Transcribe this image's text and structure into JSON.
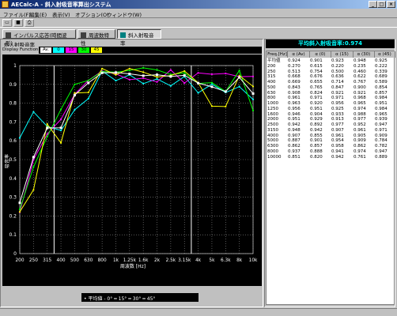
{
  "window": {
    "title": "AECalc-A - 斜入射吸音率算出システム",
    "minimize": "_",
    "maximize": "□",
    "close": "×"
  },
  "menu": [
    "ファイル(F)",
    "編集(E)",
    "表示(V)",
    "オプション(O)",
    "ウィンドウ(W)"
  ],
  "tabs": [
    {
      "label": "インパルス応答(時間波形)"
    },
    {
      "label": "周波数特性"
    },
    {
      "label": "斜入射吸音率"
    }
  ],
  "panel_title": "斜入射吸音率",
  "display_function": {
    "label": "Display Function",
    "buttons": [
      {
        "label": "Av.",
        "color": "#ffffff"
      },
      {
        "label": "0",
        "color": "#00ffff"
      },
      {
        "label": "15",
        "color": "#ff00ff"
      },
      {
        "label": "30",
        "color": "#00ff00"
      },
      {
        "label": "45",
        "color": "#ffff00"
      }
    ]
  },
  "avg_title": "平均斜入射吸音率:0.974",
  "legend": "• 平均値 - 0° ━ 15° ━ 30° ━ 45°",
  "table": {
    "headers": [
      "Freq.[Hz]",
      "α (Av)",
      "α (0)",
      "α (15)",
      "α (30)",
      "α (45)"
    ],
    "rows": [
      [
        "平均値",
        "0.924",
        "0.901",
        "0.923",
        "0.948",
        "0.925"
      ],
      [
        "200",
        "0.270",
        "0.615",
        "0.220",
        "0.235",
        "0.222"
      ],
      [
        "250",
        "0.513",
        "0.754",
        "0.500",
        "0.460",
        "0.339"
      ],
      [
        "315",
        "0.668",
        "0.676",
        "0.636",
        "0.622",
        "0.689"
      ],
      [
        "400",
        "0.669",
        "0.655",
        "0.714",
        "0.767",
        "0.589"
      ],
      [
        "500",
        "0.843",
        "0.765",
        "0.847",
        "0.900",
        "0.854"
      ],
      [
        "630",
        "0.908",
        "0.824",
        "0.921",
        "0.921",
        "0.857"
      ],
      [
        "800",
        "0.961",
        "0.971",
        "0.971",
        "0.968",
        "0.984"
      ],
      [
        "1000",
        "0.963",
        "0.920",
        "0.956",
        "0.965",
        "0.951"
      ],
      [
        "1250",
        "0.956",
        "0.951",
        "0.925",
        "0.974",
        "0.984"
      ],
      [
        "1600",
        "0.946",
        "0.904",
        "0.933",
        "0.988",
        "0.965"
      ],
      [
        "2000",
        "0.951",
        "0.929",
        "0.913",
        "0.977",
        "0.939"
      ],
      [
        "2500",
        "0.942",
        "0.892",
        "0.977",
        "0.952",
        "0.947"
      ],
      [
        "3150",
        "0.948",
        "0.942",
        "0.907",
        "0.961",
        "0.971"
      ],
      [
        "4000",
        "0.907",
        "0.855",
        "0.961",
        "0.905",
        "0.909"
      ],
      [
        "5000",
        "0.887",
        "0.901",
        "0.954",
        "0.909",
        "0.784"
      ],
      [
        "6300",
        "0.862",
        "0.857",
        "0.958",
        "0.862",
        "0.782"
      ],
      [
        "8000",
        "0.937",
        "0.888",
        "0.941",
        "0.974",
        "0.947"
      ],
      [
        "10000",
        "0.851",
        "0.820",
        "0.942",
        "0.761",
        "0.889"
      ]
    ]
  },
  "chart_data": {
    "type": "line",
    "ylabel": "吸音率",
    "xlabel": "周波数 [Hz]",
    "ylim": [
      0,
      1
    ],
    "yticks": [
      "0",
      "0.1",
      "0.2",
      "0.3",
      "0.4",
      "0.5",
      "0.6",
      "0.7",
      "0.8",
      "0.9",
      "1"
    ],
    "categories": [
      "200",
      "250",
      "315",
      "400",
      "500",
      "630",
      "800",
      "1k",
      "1.25k",
      "1.6k",
      "2k",
      "2.5k",
      "3.15k",
      "4k",
      "5k",
      "6.3k",
      "8k",
      "10k"
    ],
    "series": [
      {
        "name": "平均値",
        "color": "#ffffff",
        "values": [
          0.27,
          0.513,
          0.668,
          0.669,
          0.843,
          0.908,
          0.961,
          0.963,
          0.956,
          0.946,
          0.951,
          0.942,
          0.948,
          0.907,
          0.887,
          0.862,
          0.937,
          0.851
        ]
      },
      {
        "name": "0°",
        "color": "#00ffff",
        "values": [
          0.615,
          0.754,
          0.676,
          0.655,
          0.765,
          0.824,
          0.971,
          0.92,
          0.951,
          0.904,
          0.929,
          0.892,
          0.942,
          0.855,
          0.901,
          0.857,
          0.888,
          0.82
        ]
      },
      {
        "name": "15°",
        "color": "#ff00ff",
        "values": [
          0.22,
          0.5,
          0.636,
          0.714,
          0.847,
          0.921,
          0.971,
          0.956,
          0.925,
          0.933,
          0.913,
          0.977,
          0.907,
          0.961,
          0.954,
          0.958,
          0.941,
          0.942
        ]
      },
      {
        "name": "30°",
        "color": "#00ff00",
        "values": [
          0.235,
          0.46,
          0.622,
          0.767,
          0.9,
          0.921,
          0.968,
          0.965,
          0.974,
          0.988,
          0.977,
          0.952,
          0.961,
          0.905,
          0.909,
          0.862,
          0.974,
          0.761
        ]
      },
      {
        "name": "45°",
        "color": "#ffff00",
        "values": [
          0.222,
          0.339,
          0.689,
          0.589,
          0.854,
          0.857,
          0.984,
          0.951,
          0.984,
          0.965,
          0.939,
          0.947,
          0.971,
          0.909,
          0.784,
          0.782,
          0.947,
          0.889
        ]
      }
    ]
  }
}
